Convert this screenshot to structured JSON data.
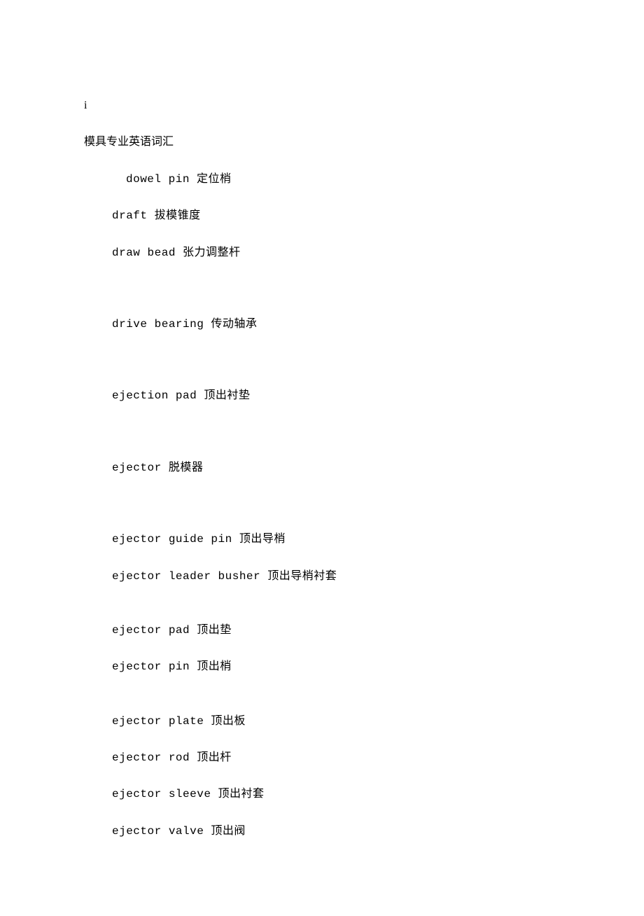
{
  "header": {
    "marker": "i",
    "title": "模具专业英语词汇"
  },
  "entries": [
    {
      "text": "dowel pin 定位梢",
      "indent": "indent-2",
      "gap": "line"
    },
    {
      "text": "draft 拔模锥度",
      "indent": "indent-1",
      "gap": "line"
    },
    {
      "text": "draw bead 张力调整杆",
      "indent": "indent-1",
      "gap": "line big-gap"
    },
    {
      "text": "drive bearing 传动轴承",
      "indent": "indent-1",
      "gap": "line big-gap"
    },
    {
      "text": "ejection pad 顶出衬垫",
      "indent": "indent-1",
      "gap": "line big-gap"
    },
    {
      "text": "ejector 脱模器",
      "indent": "indent-1",
      "gap": "line big-gap"
    },
    {
      "text": "ejector guide pin 顶出导梢",
      "indent": "indent-1",
      "gap": "line"
    },
    {
      "text": "ejector leader busher 顶出导梢衬套",
      "indent": "indent-1",
      "gap": "line med-gap"
    },
    {
      "text": "ejector pad 顶出垫",
      "indent": "indent-1",
      "gap": "line"
    },
    {
      "text": "ejector pin 顶出梢",
      "indent": "indent-1",
      "gap": "line med-gap"
    },
    {
      "text": "ejector plate 顶出板",
      "indent": "indent-1",
      "gap": "line"
    },
    {
      "text": "ejector rod 顶出杆",
      "indent": "indent-1",
      "gap": "line"
    },
    {
      "text": "ejector sleeve 顶出衬套",
      "indent": "indent-1",
      "gap": "line"
    },
    {
      "text": "ejector valve 顶出阀",
      "indent": "indent-1",
      "gap": "line"
    }
  ]
}
